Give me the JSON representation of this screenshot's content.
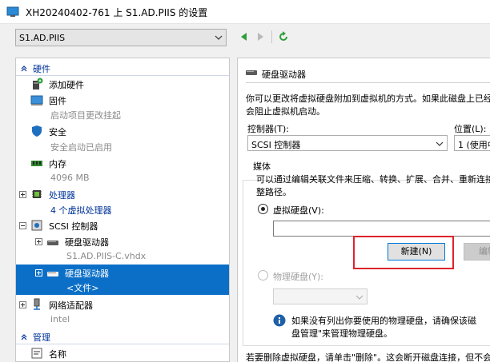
{
  "window": {
    "title": "XH20240402-761 上 S1.AD.PIIS 的设置"
  },
  "toolbar": {
    "vm_selected": "S1.AD.PIIS"
  },
  "tree": {
    "hardware_header": "硬件",
    "items": [
      {
        "label": "添加硬件",
        "sub": ""
      },
      {
        "label": "固件",
        "sub": "启动项目更改挂起"
      },
      {
        "label": "安全",
        "sub": "安全启动已启用"
      },
      {
        "label": "内存",
        "sub": "4096 MB"
      },
      {
        "label": "处理器",
        "sub": "4 个虚拟处理器"
      },
      {
        "label": "SCSI 控制器",
        "sub": ""
      },
      {
        "label": "硬盘驱动器",
        "sub": "S1.AD.PIIS-C.vhdx"
      },
      {
        "label": "硬盘驱动器",
        "sub": "<文件>"
      },
      {
        "label": "网络适配器",
        "sub": "intel"
      }
    ],
    "management_header": "管理",
    "management_items": [
      {
        "label": "名称"
      }
    ]
  },
  "panel": {
    "title": "硬盘驱动器",
    "description_line1": "你可以更改将虚拟硬盘附加到虚拟机的方式。如果此磁盘上已经",
    "description_line2": "会阻止虚拟机启动。",
    "controller_label": "控制器(T):",
    "controller_value": "SCSI 控制器",
    "location_label": "位置(L):",
    "location_value": "1 (使用中",
    "media_label": "媒体",
    "media_desc_line1": "可以通过编辑关联文件来压缩、转换、扩展、合并、重新连接",
    "media_desc_line2": "整路径。",
    "virtual_disk_label": "虚拟硬盘(V):",
    "virtual_disk_path": "",
    "new_button": "新建(N)",
    "edit_button": "编辑",
    "physical_disk_label": "物理硬盘(Y):",
    "info_line1": "如果没有列出你要使用的物理硬盘，请确保该磁",
    "info_line2": "盘管理\"来管理物理硬盘。",
    "footer_text": "若要删除虚拟硬盘，请单击\"删除\"。这会断开磁盘连接，但不会"
  },
  "colors": {
    "accent": "#0b6fc7",
    "section_header": "#003399",
    "highlight": "#e0232b",
    "nav_green": "#2e9e3a"
  }
}
